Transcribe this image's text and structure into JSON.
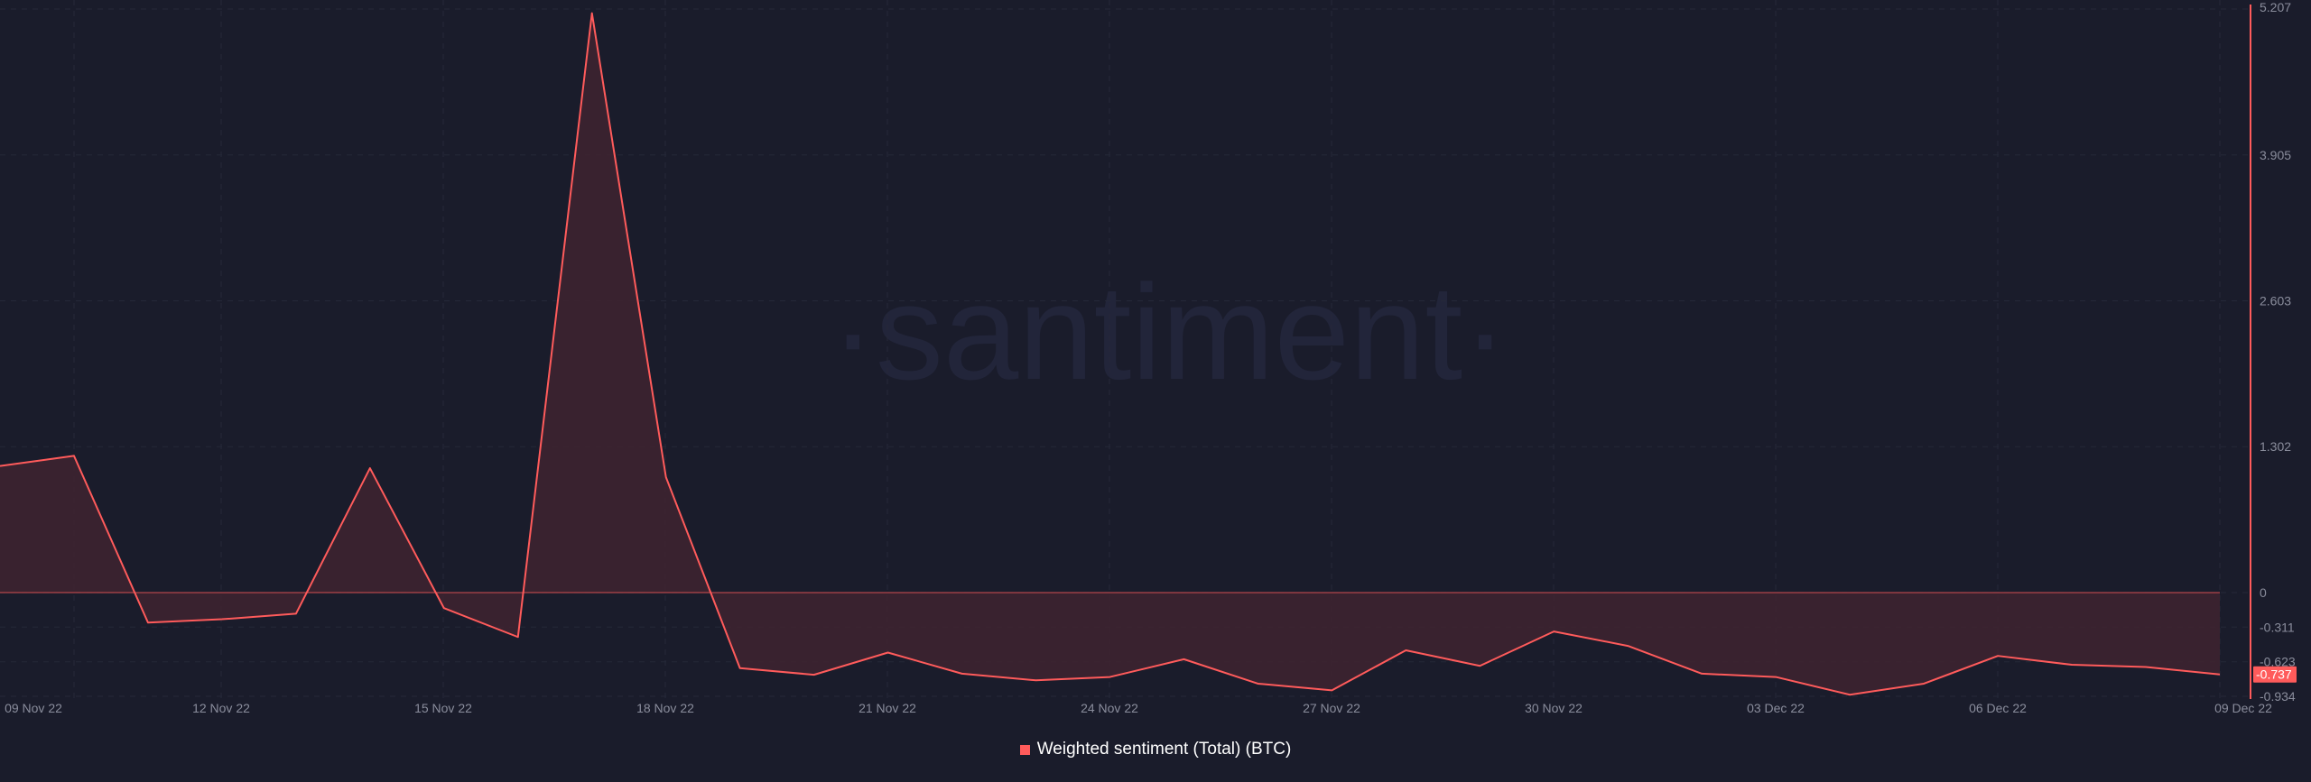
{
  "colors": {
    "background": "#1a1c2b",
    "series": "#ff5b5b",
    "fill": "#3f2330",
    "axis": "#ff5b5b",
    "text": "#8a8d9c"
  },
  "watermark": "·santiment·",
  "chart_data": {
    "type": "area",
    "x": [
      "09 Nov 22",
      "10 Nov 22",
      "11 Nov 22",
      "12 Nov 22",
      "13 Nov 22",
      "14 Nov 22",
      "15 Nov 22",
      "16 Nov 22",
      "17 Nov 22",
      "18 Nov 22",
      "19 Nov 22",
      "20 Nov 22",
      "21 Nov 22",
      "22 Nov 22",
      "23 Nov 22",
      "24 Nov 22",
      "25 Nov 22",
      "26 Nov 22",
      "27 Nov 22",
      "28 Nov 22",
      "29 Nov 22",
      "30 Nov 22",
      "01 Dec 22",
      "02 Dec 22",
      "03 Dec 22",
      "04 Dec 22",
      "05 Dec 22",
      "06 Dec 22",
      "07 Dec 22",
      "08 Dec 22",
      "09 Dec 22"
    ],
    "series": [
      {
        "name": "Weighted sentiment (Total) (BTC)",
        "values": [
          1.13,
          1.22,
          -0.27,
          -0.24,
          -0.19,
          1.11,
          -0.14,
          -0.4,
          5.17,
          1.03,
          -0.68,
          -0.74,
          -0.54,
          -0.73,
          -0.79,
          -0.76,
          -0.6,
          -0.82,
          -0.88,
          -0.52,
          -0.66,
          -0.35,
          -0.48,
          -0.73,
          -0.76,
          -0.92,
          -0.82,
          -0.57,
          -0.65,
          -0.67,
          -0.737
        ]
      }
    ],
    "x_ticks": [
      "09 Nov 22",
      "12 Nov 22",
      "15 Nov 22",
      "18 Nov 22",
      "21 Nov 22",
      "24 Nov 22",
      "27 Nov 22",
      "30 Nov 22",
      "03 Dec 22",
      "06 Dec 22",
      "09 Dec 22"
    ],
    "y_ticks": [
      "5.207",
      "3.905",
      "2.603",
      "1.302",
      "0",
      "-0.311",
      "-0.623",
      "-0.934"
    ],
    "y_tick_values": [
      5.207,
      3.905,
      2.603,
      1.302,
      0,
      -0.311,
      -0.623,
      -0.934
    ],
    "last_value_label": "-0.737",
    "ylim": [
      -0.934,
      5.207
    ],
    "grid": true,
    "legend": "bottom-center"
  }
}
